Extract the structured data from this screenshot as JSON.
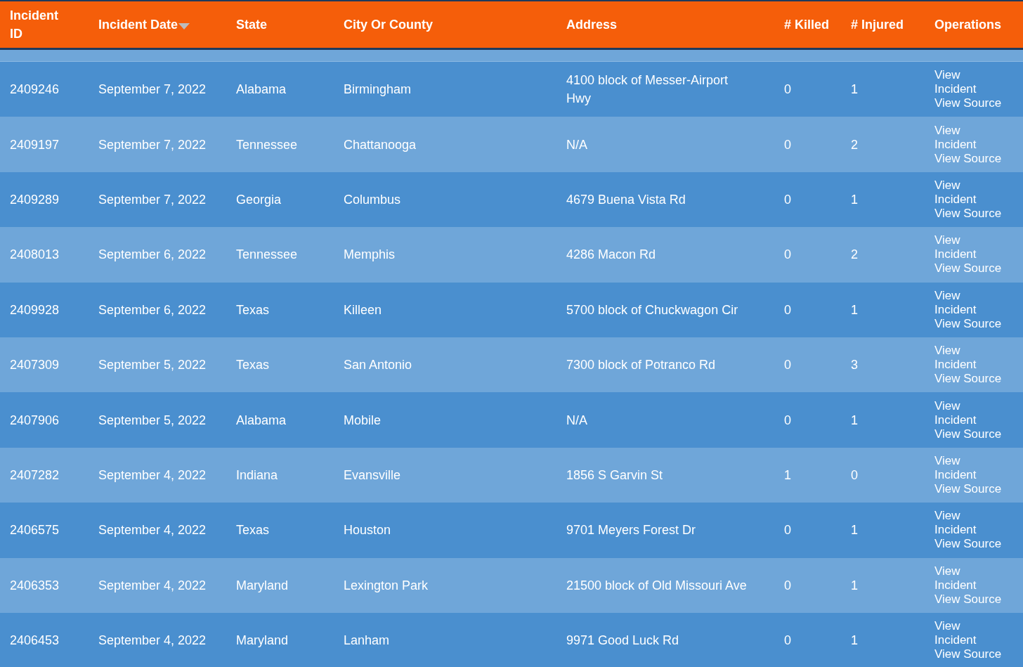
{
  "table": {
    "columns": [
      {
        "label": "Incident ID",
        "sorted": false
      },
      {
        "label": "Incident Date",
        "sorted": true
      },
      {
        "label": "State",
        "sorted": false
      },
      {
        "label": "City Or County",
        "sorted": false
      },
      {
        "label": "Address",
        "sorted": false
      },
      {
        "label": "# Killed",
        "sorted": false
      },
      {
        "label": "# Injured",
        "sorted": false
      },
      {
        "label": "Operations",
        "sorted": false
      }
    ],
    "rows": [
      {
        "cells": [
          "2409246",
          "September 7, 2022",
          "Alabama",
          "Birmingham",
          "4100 block of Messer-Airport Hwy",
          "0",
          "1"
        ],
        "links": [
          "View Incident",
          "View Source"
        ]
      },
      {
        "cells": [
          "2409197",
          "September 7, 2022",
          "Tennessee",
          "Chattanooga",
          "N/A",
          "0",
          "2"
        ],
        "links": [
          "View Incident",
          "View Source"
        ]
      },
      {
        "cells": [
          "2409289",
          "September 7, 2022",
          "Georgia",
          "Columbus",
          "4679 Buena Vista Rd",
          "0",
          "1"
        ],
        "links": [
          "View Incident",
          "View Source"
        ]
      },
      {
        "cells": [
          "2408013",
          "September 6, 2022",
          "Tennessee",
          "Memphis",
          "4286 Macon Rd",
          "0",
          "2"
        ],
        "links": [
          "View Incident",
          "View Source"
        ]
      },
      {
        "cells": [
          "2409928",
          "September 6, 2022",
          "Texas",
          "Killeen",
          "5700 block of Chuckwagon Cir",
          "0",
          "1"
        ],
        "links": [
          "View Incident",
          "View Source"
        ]
      },
      {
        "cells": [
          "2407309",
          "September 5, 2022",
          "Texas",
          "San Antonio",
          "7300 block of Potranco Rd",
          "0",
          "3"
        ],
        "links": [
          "View Incident",
          "View Source"
        ]
      },
      {
        "cells": [
          "2407906",
          "September 5, 2022",
          "Alabama",
          "Mobile",
          "N/A",
          "0",
          "1"
        ],
        "links": [
          "View Incident",
          "View Source"
        ]
      },
      {
        "cells": [
          "2407282",
          "September 4, 2022",
          "Indiana",
          "Evansville",
          "1856 S Garvin St",
          "1",
          "0"
        ],
        "links": [
          "View Incident",
          "View Source"
        ]
      },
      {
        "cells": [
          "2406575",
          "September 4, 2022",
          "Texas",
          "Houston",
          "9701 Meyers Forest Dr",
          "0",
          "1"
        ],
        "links": [
          "View Incident",
          "View Source"
        ]
      },
      {
        "cells": [
          "2406353",
          "September 4, 2022",
          "Maryland",
          "Lexington Park",
          "21500 block of Old Missouri Ave",
          "0",
          "1"
        ],
        "links": [
          "View Incident",
          "View Source"
        ]
      },
      {
        "cells": [
          "2406453",
          "September 4, 2022",
          "Maryland",
          "Lanham",
          "9971 Good Luck Rd",
          "0",
          "1"
        ],
        "links": [
          "View Incident",
          "View Source"
        ]
      }
    ]
  }
}
